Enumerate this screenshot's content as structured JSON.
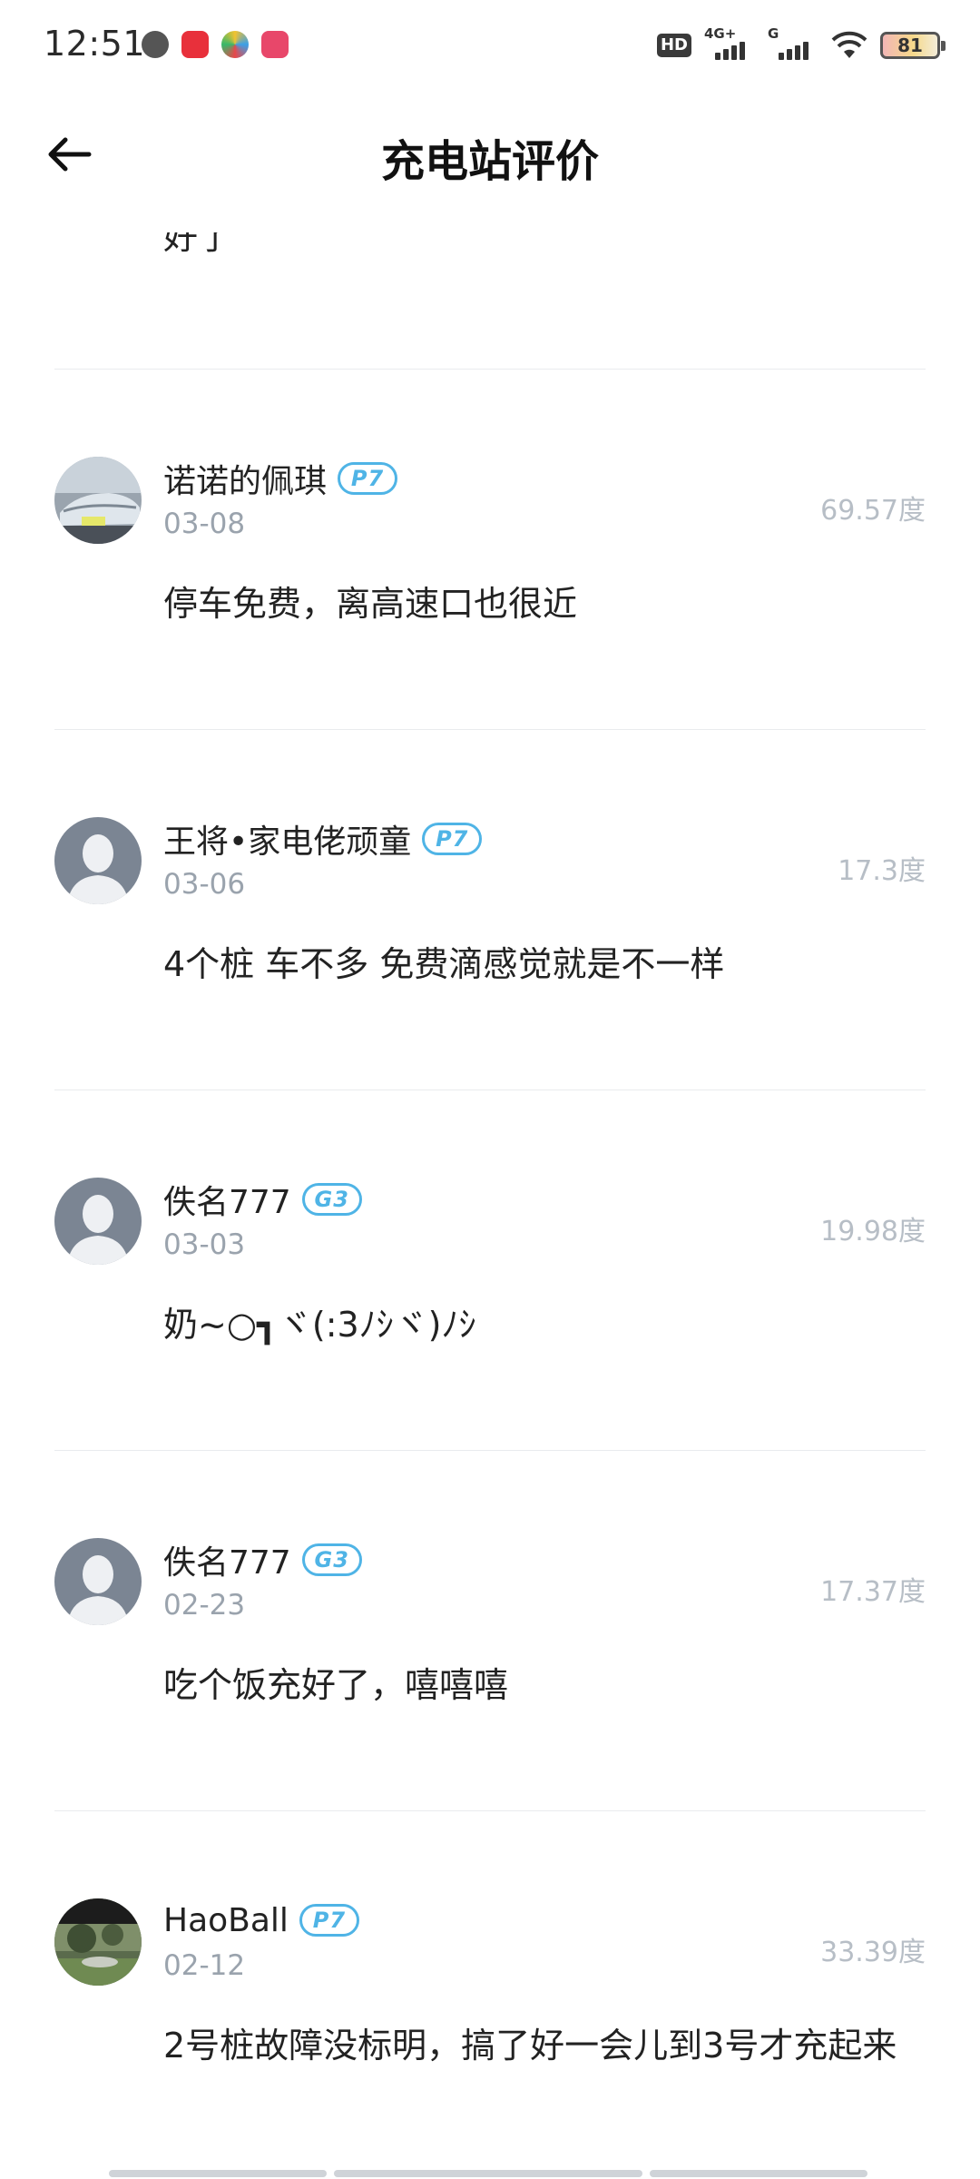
{
  "status_bar": {
    "time": "12:51",
    "battery_level": "81",
    "hd_label": "HD",
    "network_4g": "4G+",
    "network_g": "G"
  },
  "header": {
    "title": "充电站评价"
  },
  "partial_text": "好了",
  "reviews": [
    {
      "user": "诺诺的佩琪",
      "car_model": "P7",
      "date": "03-08",
      "energy": "69.57度",
      "text": "停车免费，离高速口也很近",
      "avatar": "car-photo"
    },
    {
      "user": "王将•家电佬顽童",
      "car_model": "P7",
      "date": "03-06",
      "energy": "17.3度",
      "text": "4个桩 车不多 免费滴感觉就是不一样",
      "avatar": "default"
    },
    {
      "user": "佚名777",
      "car_model": "G3",
      "date": "03-03",
      "energy": "19.98度",
      "text": "奶~○┓ヾ(:3ﾉｼヾ)ﾉｼ",
      "avatar": "default"
    },
    {
      "user": "佚名777",
      "car_model": "G3",
      "date": "02-23",
      "energy": "17.37度",
      "text": "吃个饭充好了，嘻嘻嘻",
      "avatar": "default"
    },
    {
      "user": "HaoBall",
      "car_model": "P7",
      "date": "02-12",
      "energy": "33.39度",
      "text": "2号桩故障没标明，搞了好一会儿到3号才充起来",
      "avatar": "park-photo"
    }
  ],
  "colors": {
    "badge": "#4fb4e6",
    "date": "#9aa3ad",
    "energy": "#b7bec6",
    "divider": "#e9ebee"
  }
}
